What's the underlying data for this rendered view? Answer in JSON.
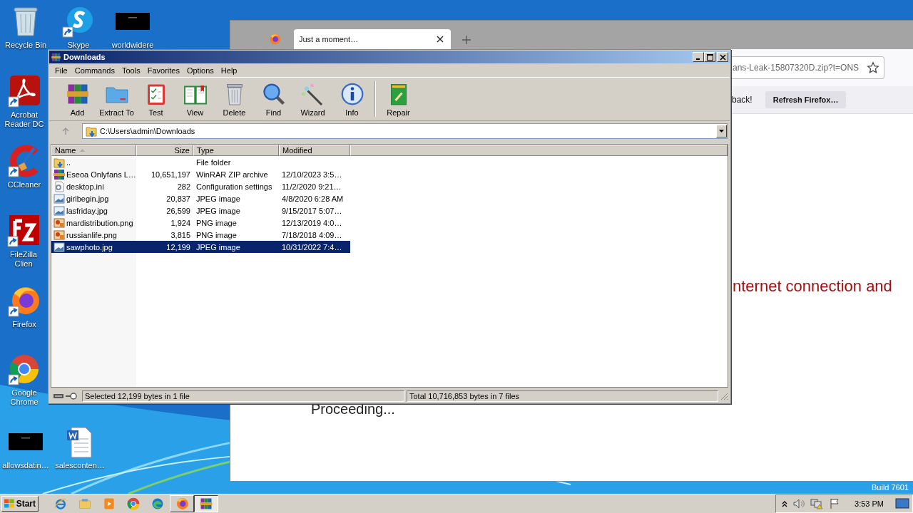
{
  "desktop": {
    "icons": [
      {
        "label": "Recycle Bin",
        "kind": "recycle-bin"
      },
      {
        "label": "Skype",
        "kind": "skype"
      },
      {
        "label": "worldwidere",
        "kind": "blank"
      },
      {
        "label": "Acrobat Reader DC",
        "kind": "acrobat"
      },
      {
        "label": "CCleaner",
        "kind": "ccleaner"
      },
      {
        "label": "FileZilla Clien",
        "kind": "filezilla"
      },
      {
        "label": "Firefox",
        "kind": "firefox"
      },
      {
        "label": "Google Chrome",
        "kind": "chrome"
      },
      {
        "label": "allowsdatin…",
        "kind": "blank"
      },
      {
        "label": "salesconten…",
        "kind": "word"
      }
    ],
    "build": "Build 7601"
  },
  "browser": {
    "tab_title": "Just a moment…",
    "url": "ans-Leak-15807320D.zip?t=ONS",
    "notice": "back!",
    "notice_button": "Refresh Firefox…",
    "error_text": "nternet connection and",
    "progress_text": "Proceeding..."
  },
  "winrar": {
    "title": "Downloads",
    "menu": [
      "File",
      "Commands",
      "Tools",
      "Favorites",
      "Options",
      "Help"
    ],
    "toolbar": [
      {
        "label": "Add",
        "kind": "add"
      },
      {
        "label": "Extract To",
        "kind": "extract"
      },
      {
        "label": "Test",
        "kind": "test"
      },
      {
        "label": "View",
        "kind": "view"
      },
      {
        "label": "Delete",
        "kind": "delete"
      },
      {
        "label": "Find",
        "kind": "find"
      },
      {
        "label": "Wizard",
        "kind": "wizard"
      },
      {
        "label": "Info",
        "kind": "info"
      },
      {
        "label": "Repair",
        "kind": "repair"
      }
    ],
    "path": "C:\\Users\\admin\\Downloads",
    "columns": [
      {
        "label": "Name",
        "sorted": true
      },
      {
        "label": "Size",
        "sorted": false
      },
      {
        "label": "Type",
        "sorted": false
      },
      {
        "label": "Modified",
        "sorted": false
      }
    ],
    "rows": [
      {
        "name": "..",
        "size": "",
        "type": "File folder",
        "modified": "",
        "kind": "folder-up",
        "selected": false
      },
      {
        "name": "Eseoa Onlyfans L…",
        "size": "10,651,197",
        "type": "WinRAR ZIP archive",
        "modified": "12/10/2023 3:5…",
        "kind": "winrar",
        "selected": false
      },
      {
        "name": "desktop.ini",
        "size": "282",
        "type": "Configuration settings",
        "modified": "11/2/2020 9:21…",
        "kind": "ini",
        "selected": false
      },
      {
        "name": "girlbegin.jpg",
        "size": "20,837",
        "type": "JPEG image",
        "modified": "4/8/2020 6:28 AM",
        "kind": "jpg",
        "selected": false
      },
      {
        "name": "lasfriday.jpg",
        "size": "26,599",
        "type": "JPEG image",
        "modified": "9/15/2017 5:07…",
        "kind": "jpg",
        "selected": false
      },
      {
        "name": "mardistribution.png",
        "size": "1,924",
        "type": "PNG image",
        "modified": "12/13/2019 4:0…",
        "kind": "png",
        "selected": false
      },
      {
        "name": "russianlife.png",
        "size": "3,815",
        "type": "PNG image",
        "modified": "7/18/2018 4:09…",
        "kind": "png",
        "selected": false
      },
      {
        "name": "sawphoto.jpg",
        "size": "12,199",
        "type": "JPEG image",
        "modified": "10/31/2022 7:4…",
        "kind": "jpg",
        "selected": true
      }
    ],
    "status_left": "Selected 12,199 bytes in 1 file",
    "status_right": "Total 10,716,853 bytes in 7 files"
  },
  "taskbar": {
    "start": "Start",
    "apps": [
      {
        "kind": "ie",
        "open": false,
        "selected": false
      },
      {
        "kind": "explorer",
        "open": false,
        "selected": false
      },
      {
        "kind": "media",
        "open": false,
        "selected": false
      },
      {
        "kind": "chrome",
        "open": false,
        "selected": false
      },
      {
        "kind": "edge",
        "open": false,
        "selected": false
      },
      {
        "kind": "firefox",
        "open": true,
        "selected": false
      },
      {
        "kind": "winrar",
        "open": true,
        "selected": true
      }
    ],
    "time": "3:53 PM"
  }
}
